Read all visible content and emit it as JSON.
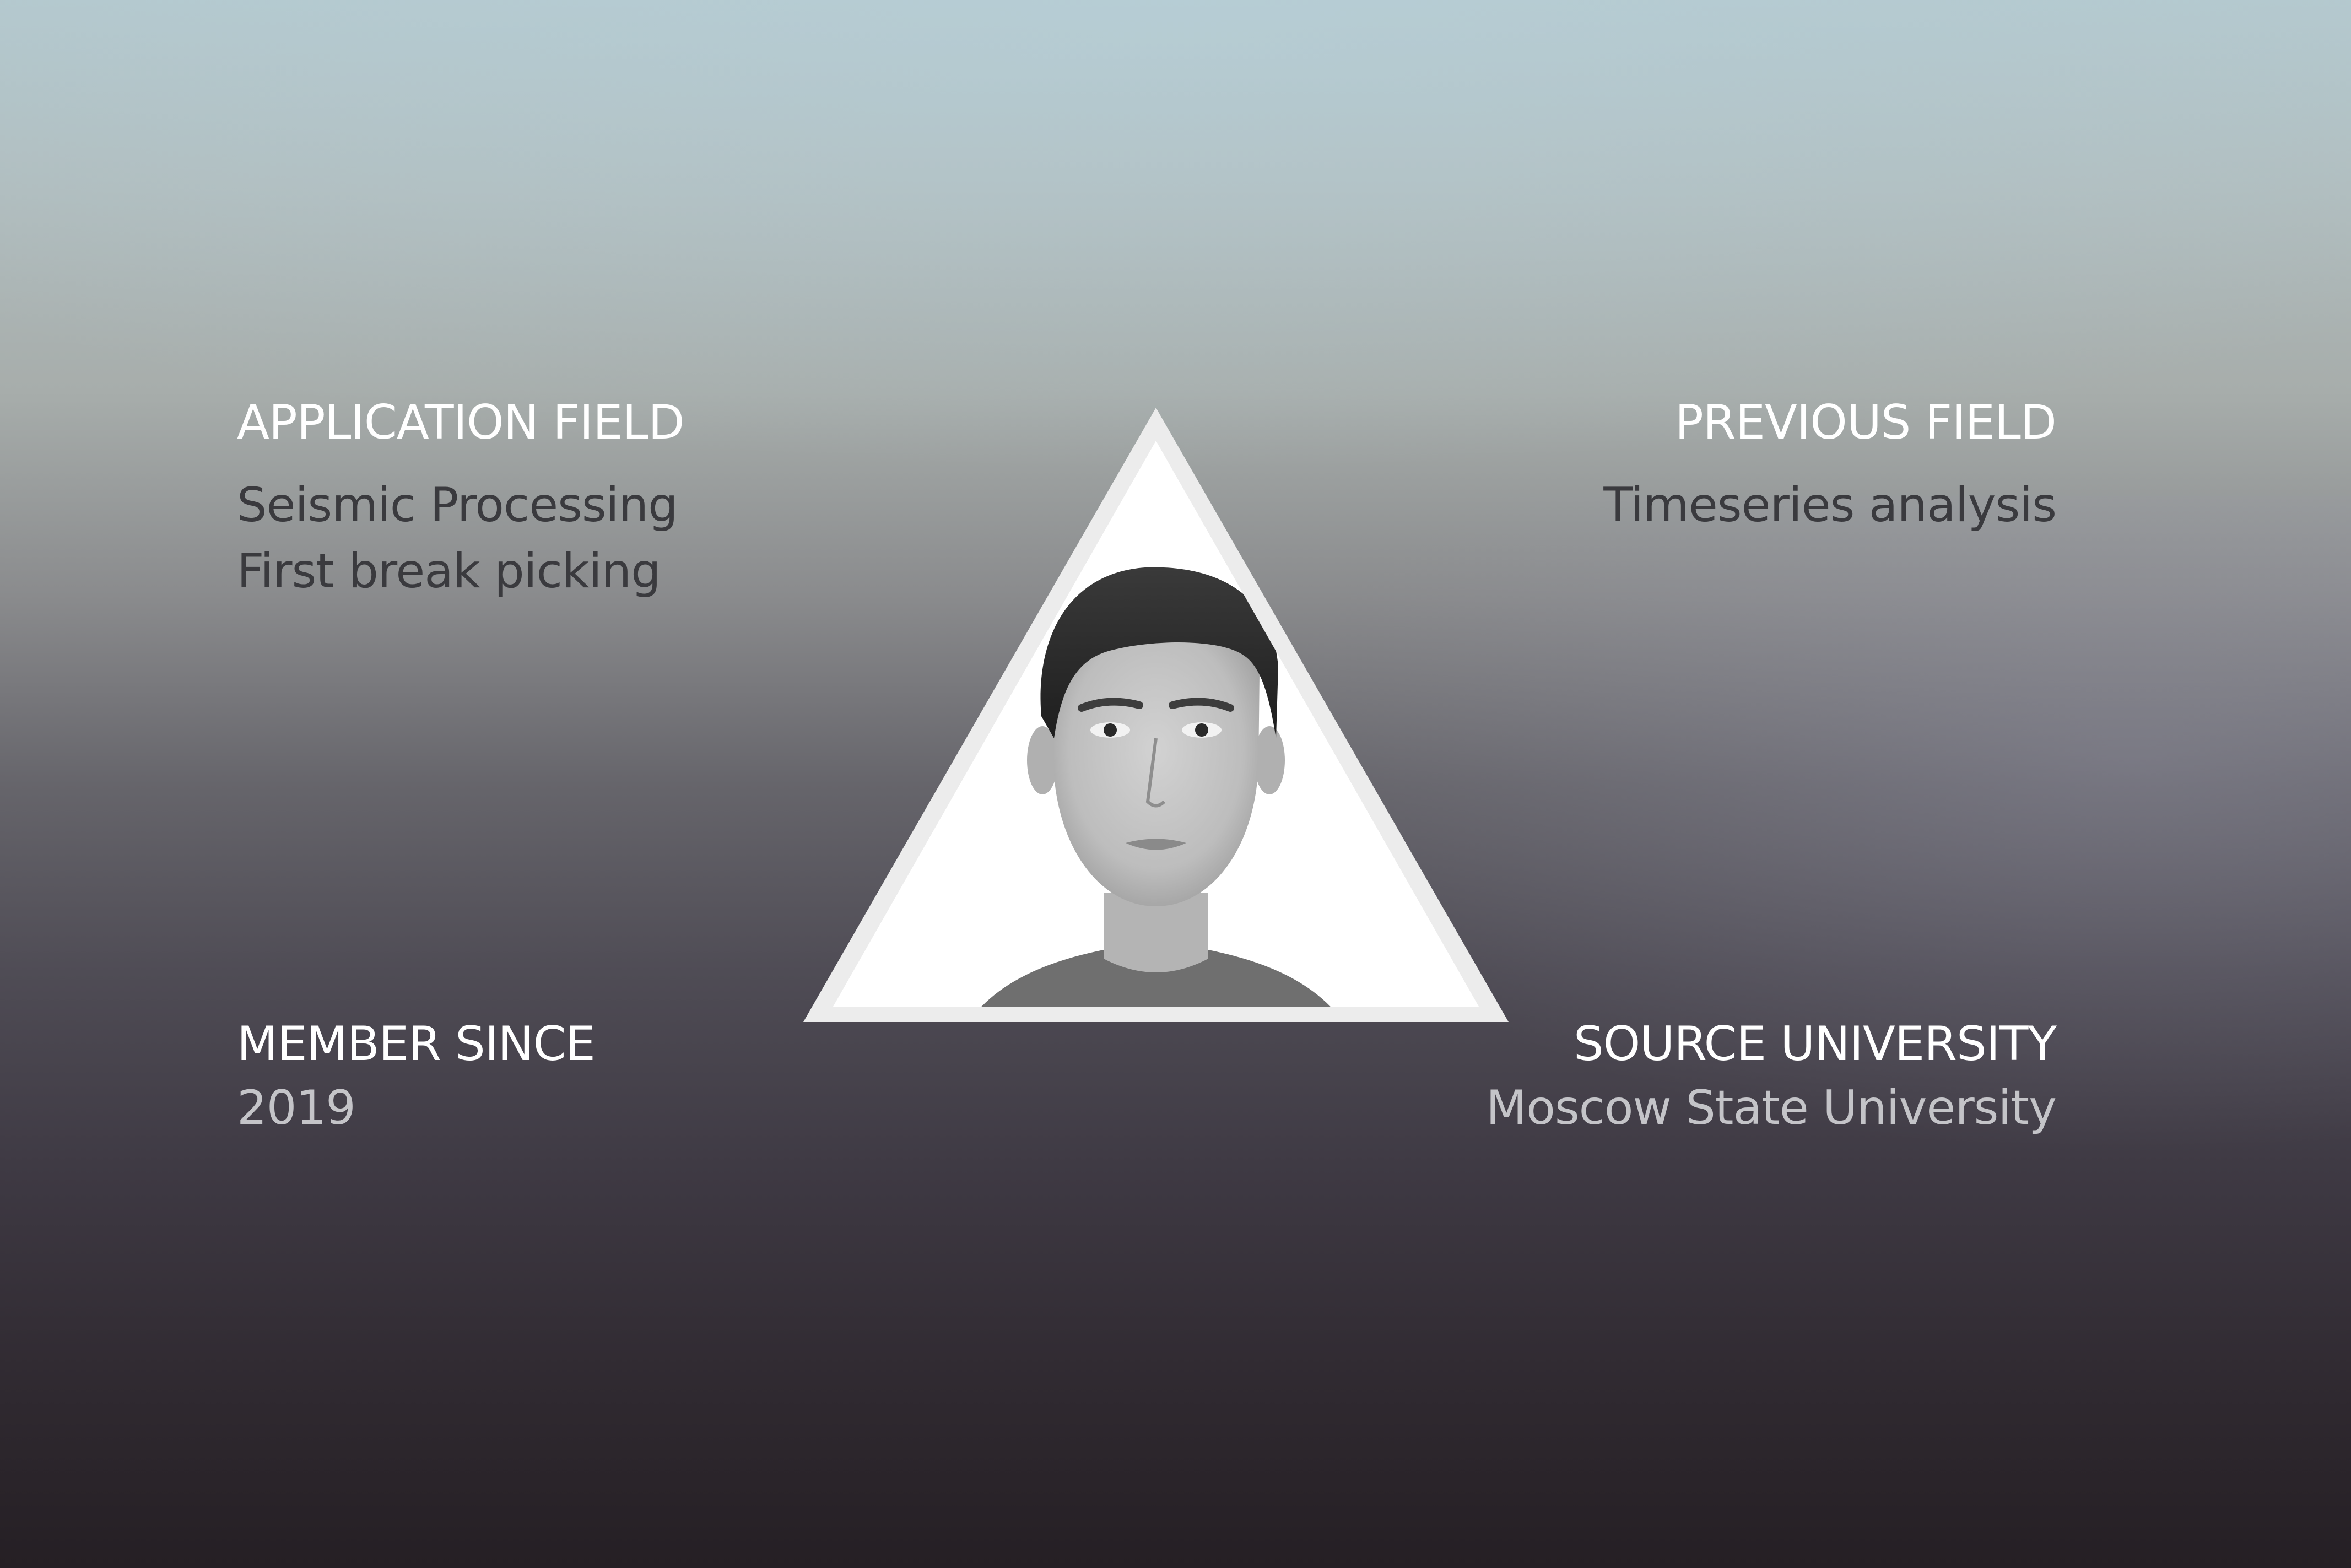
{
  "profile": {
    "application_field": {
      "heading": "APPLICATION FIELD",
      "lines": [
        "Seismic Processing",
        "First break picking"
      ]
    },
    "previous_field": {
      "heading": "PREVIOUS FIELD",
      "lines": [
        "Timeseries analysis"
      ]
    },
    "member_since": {
      "heading": "MEMBER SINCE",
      "value": "2019"
    },
    "source_university": {
      "heading": "SOURCE UNIVERSITY",
      "value": "Moscow State University"
    }
  },
  "colors": {
    "heading": "#ffffff",
    "value_dark": "#3a3a3e",
    "value_light": "#c4c4c8",
    "triangle_frame": "#ececec",
    "triangle_fill": "#ffffff"
  }
}
